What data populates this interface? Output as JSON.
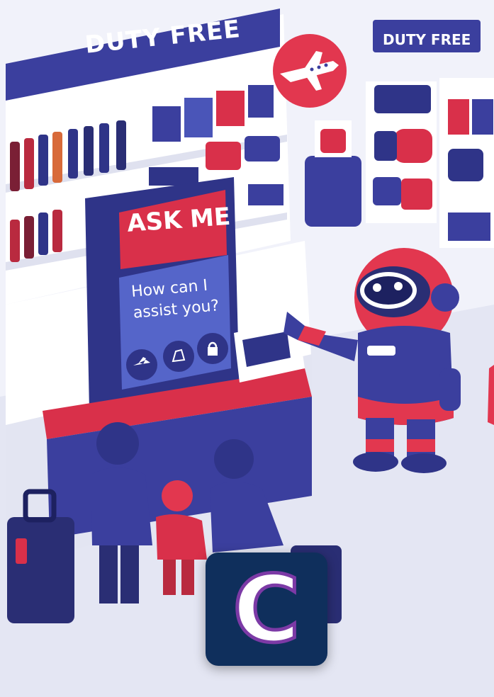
{
  "scene": {
    "description_colors": {
      "navy": "#3b3f9e",
      "red": "#d9304a",
      "floor": "#e7e8f4",
      "wall": "#f1f2fa"
    },
    "signs": {
      "main": "DUTY FREE",
      "secondary": "DUTY FREE"
    },
    "kiosk": {
      "title": "ASK ME",
      "prompt": "How can I\nassist you?"
    },
    "icons": [
      "airplane-icon",
      "shopping-bag-icon",
      "lock-icon"
    ],
    "logo": {
      "letter": "C",
      "bg": "#0f2f5c",
      "outline": "#7c3aa6"
    }
  }
}
